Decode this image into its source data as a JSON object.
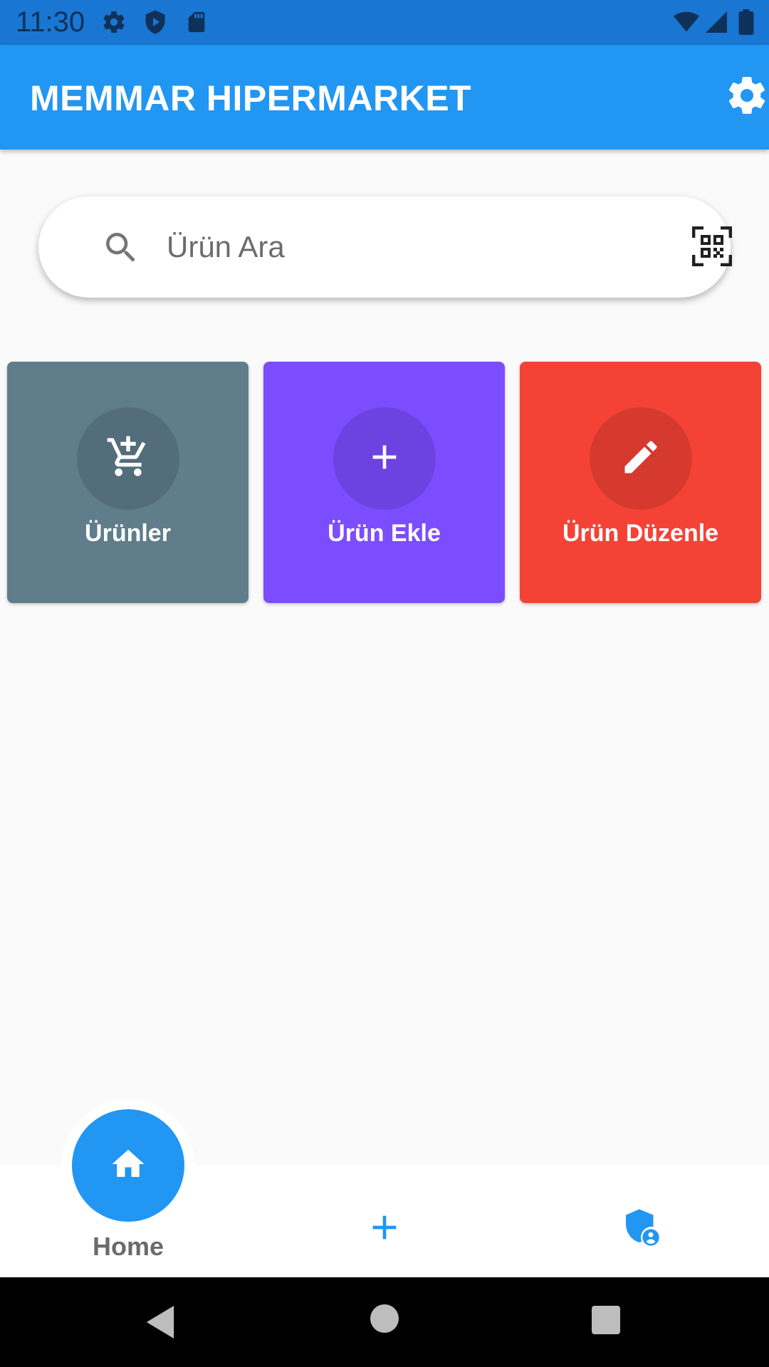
{
  "status_bar": {
    "time": "11:30",
    "icons_left": [
      "gear-icon",
      "shield-play-icon",
      "sd-card-icon"
    ],
    "icons_right": [
      "wifi-icon",
      "cell-signal-icon",
      "battery-icon"
    ]
  },
  "app_bar": {
    "title": "MEMMAR HIPERMARKET",
    "settings_icon": "gear-icon"
  },
  "search": {
    "placeholder": "Ürün Ara",
    "value": ""
  },
  "tiles": [
    {
      "label": "Ürünler",
      "icon": "cart-add-icon",
      "color": "#607d8b"
    },
    {
      "label": "Ürün Ekle",
      "icon": "plus-icon",
      "color": "#7c4dff"
    },
    {
      "label": "Ürün Düzenle",
      "icon": "pencil-icon",
      "color": "#f44336"
    }
  ],
  "bottom_nav": {
    "home_label": "Home",
    "accent": "#2196f3",
    "items": [
      "home-icon",
      "plus-icon",
      "admin-shield-icon"
    ]
  },
  "colors": {
    "primary": "#2196f3",
    "status_bar": "#1976d2",
    "background": "#fafafa"
  }
}
